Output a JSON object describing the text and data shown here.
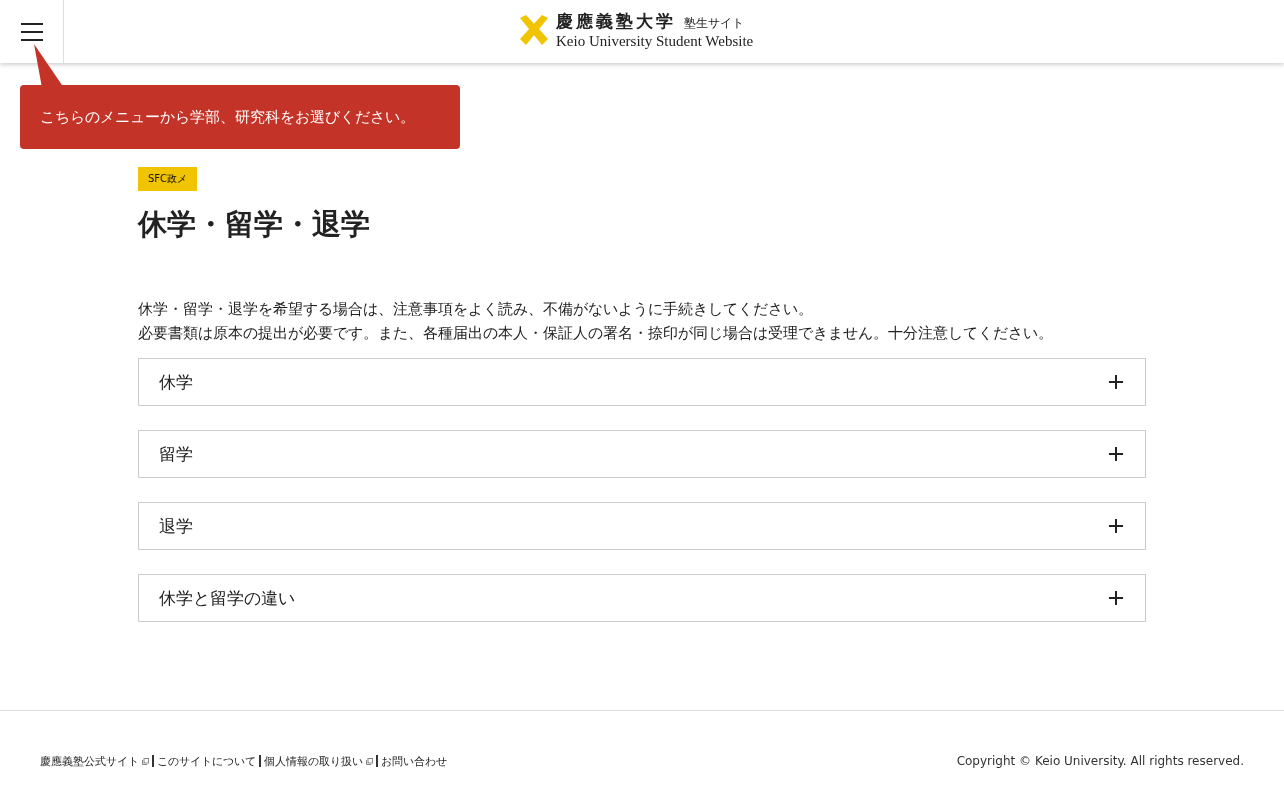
{
  "header": {
    "logo_title": "慶應義塾大学",
    "logo_sub": "塾生サイト",
    "logo_en": "Keio University Student Website"
  },
  "tooltip": "こちらのメニューから学部、研究科をお選びください。",
  "tag": "SFC政メ",
  "title": "休学・留学・退学",
  "intro": [
    "休学・留学・退学を希望する場合は、注意事項をよく読み、不備がないように手続きしてください。",
    "必要書類は原本の提出が必要です。また、各種届出の本人・保証人の署名・捺印が同じ場合は受理できません。十分注意してください。"
  ],
  "accordion": [
    {
      "label": "休学",
      "expanded": false
    },
    {
      "label": "留学",
      "expanded": false
    },
    {
      "label": "退学",
      "expanded": false
    },
    {
      "label": "休学と留学の違い",
      "expanded": false
    }
  ],
  "footer": {
    "links": [
      {
        "label": "慶應義塾公式サイト",
        "external": true
      },
      {
        "label": "このサイトについて",
        "external": false
      },
      {
        "label": "個人情報の取り扱い",
        "external": true
      },
      {
        "label": "お問い合わせ",
        "external": false
      }
    ],
    "copyright": "Copyright © Keio University. All rights reserved."
  }
}
